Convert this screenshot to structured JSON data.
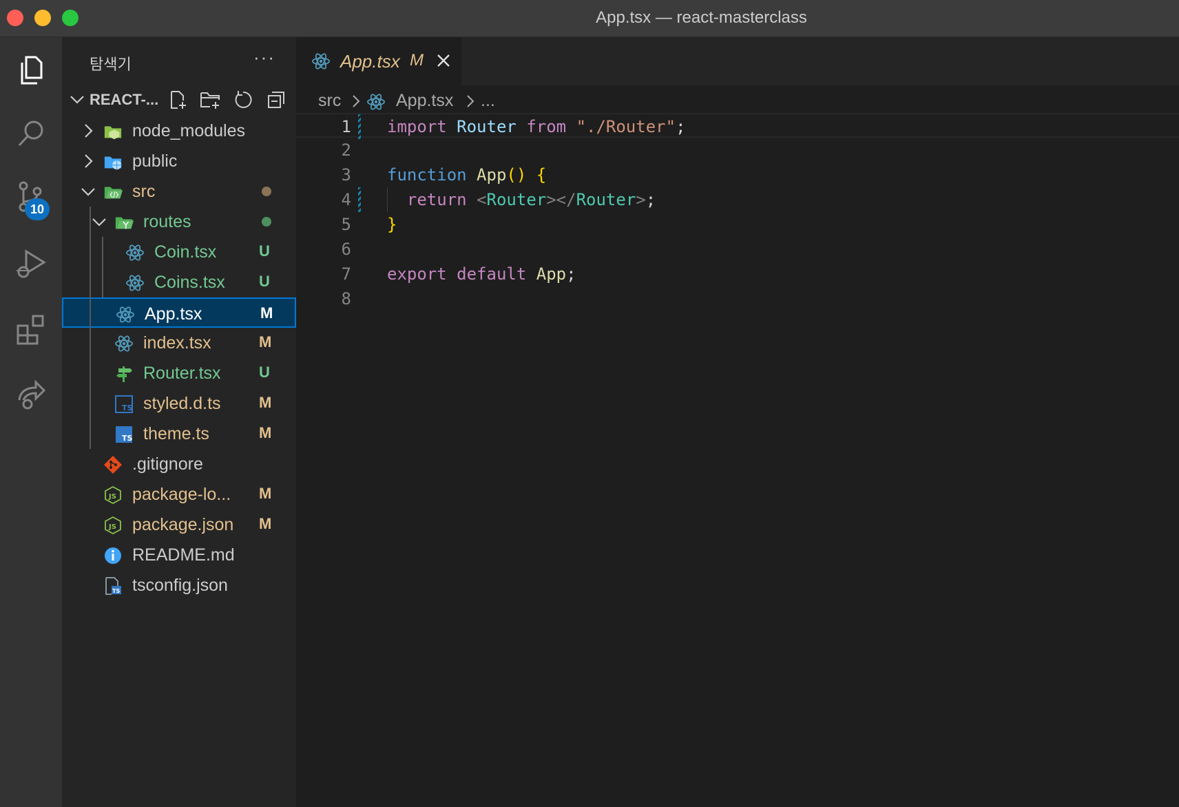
{
  "window": {
    "title": "App.tsx — react-masterclass"
  },
  "activity": {
    "scm_badge": "10"
  },
  "sidebar": {
    "title": "탐색기",
    "more": "···",
    "section": "REACT-...",
    "tree": [
      {
        "label": "node_modules",
        "kind": "folder-node",
        "depth": 0,
        "chevron": "right",
        "color": "#cccccc",
        "status": "",
        "dot": ""
      },
      {
        "label": "public",
        "kind": "folder-public",
        "depth": 0,
        "chevron": "right",
        "color": "#cccccc",
        "status": "",
        "dot": ""
      },
      {
        "label": "src",
        "kind": "folder-src",
        "depth": 0,
        "chevron": "down",
        "color": "#e2c08d",
        "status": "",
        "dot": "#8a7357"
      },
      {
        "label": "routes",
        "kind": "folder-routes",
        "depth": 1,
        "chevron": "down",
        "color": "#73c991",
        "status": "",
        "dot": "#4e8f5f"
      },
      {
        "label": "Coin.tsx",
        "kind": "react",
        "depth": 2,
        "chevron": "",
        "color": "#73c991",
        "status": "U",
        "statusColor": "#73c991"
      },
      {
        "label": "Coins.tsx",
        "kind": "react",
        "depth": 2,
        "chevron": "",
        "color": "#73c991",
        "status": "U",
        "statusColor": "#73c991"
      },
      {
        "label": "App.tsx",
        "kind": "react",
        "depth": 1,
        "chevron": "",
        "color": "#ffffff",
        "status": "M",
        "statusColor": "#ffffff",
        "selected": true
      },
      {
        "label": "index.tsx",
        "kind": "react",
        "depth": 1,
        "chevron": "",
        "color": "#e2c08d",
        "status": "M",
        "statusColor": "#e2c08d"
      },
      {
        "label": "Router.tsx",
        "kind": "router",
        "depth": 1,
        "chevron": "",
        "color": "#73c991",
        "status": "U",
        "statusColor": "#73c991"
      },
      {
        "label": "styled.d.ts",
        "kind": "ts-outline",
        "depth": 1,
        "chevron": "",
        "color": "#e2c08d",
        "status": "M",
        "statusColor": "#e2c08d"
      },
      {
        "label": "theme.ts",
        "kind": "ts",
        "depth": 1,
        "chevron": "",
        "color": "#e2c08d",
        "status": "M",
        "statusColor": "#e2c08d"
      },
      {
        "label": ".gitignore",
        "kind": "git",
        "depth": 0,
        "chevron": "",
        "color": "#cccccc",
        "status": ""
      },
      {
        "label": "package-lo...",
        "kind": "node",
        "depth": 0,
        "chevron": "",
        "color": "#e2c08d",
        "status": "M",
        "statusColor": "#e2c08d"
      },
      {
        "label": "package.json",
        "kind": "node",
        "depth": 0,
        "chevron": "",
        "color": "#e2c08d",
        "status": "M",
        "statusColor": "#e2c08d"
      },
      {
        "label": "README.md",
        "kind": "info",
        "depth": 0,
        "chevron": "",
        "color": "#cccccc",
        "status": ""
      },
      {
        "label": "tsconfig.json",
        "kind": "tsconfig",
        "depth": 0,
        "chevron": "",
        "color": "#cccccc",
        "status": ""
      }
    ]
  },
  "editor": {
    "tab": {
      "name": "App.tsx",
      "status": "M"
    },
    "breadcrumbs": {
      "folder": "src",
      "file": "App.tsx",
      "more": "..."
    },
    "lines": [
      [
        {
          "t": "import",
          "c": "kw"
        },
        {
          "t": " "
        },
        {
          "t": "Router",
          "c": "var"
        },
        {
          "t": " "
        },
        {
          "t": "from",
          "c": "kw"
        },
        {
          "t": " "
        },
        {
          "t": "\"./Router\"",
          "c": "str"
        },
        {
          "t": ";"
        }
      ],
      [],
      [
        {
          "t": "function",
          "c": "kwb"
        },
        {
          "t": " "
        },
        {
          "t": "App",
          "c": "fn"
        },
        {
          "t": "()",
          "c": "br"
        },
        {
          "t": " "
        },
        {
          "t": "{",
          "c": "br"
        }
      ],
      [
        {
          "t": "  "
        },
        {
          "t": "return",
          "c": "kw"
        },
        {
          "t": " "
        },
        {
          "t": "<",
          "c": "ang"
        },
        {
          "t": "Router",
          "c": "tag"
        },
        {
          "t": "></",
          "c": "ang"
        },
        {
          "t": "Router",
          "c": "tag"
        },
        {
          "t": ">",
          "c": "ang"
        },
        {
          "t": ";"
        }
      ],
      [
        {
          "t": "}",
          "c": "br"
        }
      ],
      [],
      [
        {
          "t": "export",
          "c": "kw"
        },
        {
          "t": " "
        },
        {
          "t": "default",
          "c": "kw"
        },
        {
          "t": " "
        },
        {
          "t": "App",
          "c": "fn"
        },
        {
          "t": ";"
        }
      ],
      []
    ]
  },
  "colors": {
    "accent": "#0078d4",
    "modified": "#e2c08d",
    "untracked": "#73c991"
  }
}
